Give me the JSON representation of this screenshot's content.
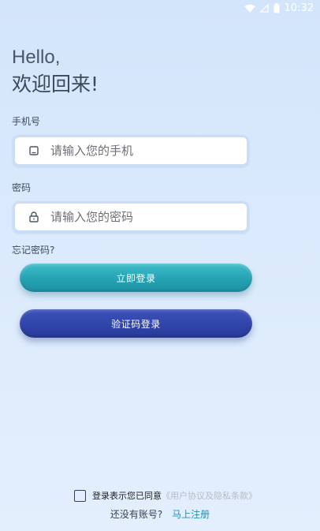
{
  "status_bar": {
    "time": "10:32",
    "icons": [
      "wifi-icon",
      "signal-icon",
      "battery-icon"
    ]
  },
  "greeting": {
    "line1": "Hello,",
    "line2": "欢迎回来!"
  },
  "phone": {
    "label": "手机号",
    "placeholder": "请输入您的手机",
    "value": "",
    "icon": "phone-icon"
  },
  "password": {
    "label": "密码",
    "placeholder": "请输入您的密码",
    "value": "",
    "icon": "lock-icon"
  },
  "forgot_label": "忘记密码?",
  "buttons": {
    "login": "立即登录",
    "code_login": "验证码登录"
  },
  "agreement": {
    "checked": false,
    "text": "登录表示您已同意",
    "link": "《用户协议及隐私条款》"
  },
  "register": {
    "question": "还没有账号?",
    "link": "马上注册"
  },
  "colors": {
    "login_button": "#2aa7b8",
    "code_button": "#3246ad",
    "register_link": "#2a8fb0",
    "background": "#d7e7fb"
  }
}
